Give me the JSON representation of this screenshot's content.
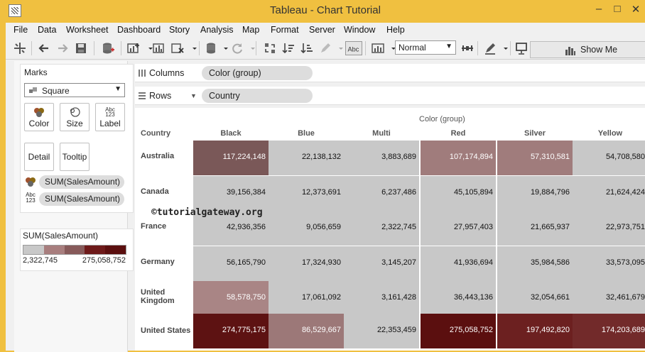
{
  "window": {
    "title": "Tableau - Chart Tutorial",
    "minimize": "‒",
    "maximize": "□",
    "close": "✕"
  },
  "menu": [
    "File",
    "Data",
    "Worksheet",
    "Dashboard",
    "Story",
    "Analysis",
    "Map",
    "Format",
    "Server",
    "Window",
    "Help"
  ],
  "toolbar": {
    "fit_value": "Normal",
    "show_me": "Show Me"
  },
  "marks": {
    "title": "Marks",
    "mark_type": "Square",
    "buttons": [
      "Color",
      "Size",
      "Label",
      "Detail",
      "Tooltip"
    ],
    "pills": [
      "SUM(SalesAmount)",
      "SUM(SalesAmount)"
    ],
    "label_icon_text": "Abc\n123"
  },
  "legend": {
    "title": "SUM(SalesAmount)",
    "min": "2,322,745",
    "max": "275,058,752",
    "colors": [
      "#c8c8c8",
      "#a87e7e",
      "#875a5a",
      "#6e1a1a",
      "#5b0f0f"
    ]
  },
  "shelves": {
    "columns_label": "Columns",
    "columns_pill": "Color (group)",
    "rows_label": "Rows",
    "rows_pill": "Country"
  },
  "table": {
    "group_title": "Color (group)",
    "row_header_title": "Country",
    "columns": [
      "Black",
      "Blue",
      "Multi",
      "Red",
      "Silver",
      "Yellow"
    ],
    "rows": [
      {
        "country": "Australia",
        "values": [
          "117,224,148",
          "22,138,132",
          "3,883,689",
          "107,174,894",
          "57,310,581",
          "54,708,580"
        ],
        "bg": [
          "#7a5858",
          "#c8c8c8",
          "#c8c8c8",
          "#a07c7c",
          "#a07c7c",
          "#c8c8c8"
        ],
        "fg": [
          "#fff",
          "#111",
          "#111",
          "#fff",
          "#fff",
          "#111"
        ]
      },
      {
        "country": "Canada",
        "values": [
          "39,156,384",
          "12,373,691",
          "6,237,486",
          "45,105,894",
          "19,884,796",
          "21,624,424"
        ],
        "bg": [
          "#c8c8c8",
          "#c8c8c8",
          "#c8c8c8",
          "#c8c8c8",
          "#c8c8c8",
          "#c8c8c8"
        ],
        "fg": [
          "#111",
          "#111",
          "#111",
          "#111",
          "#111",
          "#111"
        ]
      },
      {
        "country": "France",
        "values": [
          "42,936,356",
          "9,056,659",
          "2,322,745",
          "27,957,403",
          "21,665,937",
          "22,973,751"
        ],
        "bg": [
          "#c8c8c8",
          "#c8c8c8",
          "#c8c8c8",
          "#c8c8c8",
          "#c8c8c8",
          "#c8c8c8"
        ],
        "fg": [
          "#111",
          "#111",
          "#111",
          "#111",
          "#111",
          "#111"
        ]
      },
      {
        "country": "Germany",
        "values": [
          "56,165,790",
          "17,324,930",
          "3,145,207",
          "41,936,694",
          "35,984,586",
          "33,573,095"
        ],
        "bg": [
          "#c8c8c8",
          "#c8c8c8",
          "#c8c8c8",
          "#c8c8c8",
          "#c8c8c8",
          "#c8c8c8"
        ],
        "fg": [
          "#111",
          "#111",
          "#111",
          "#111",
          "#111",
          "#111"
        ]
      },
      {
        "country": "United Kingdom",
        "values": [
          "58,578,750",
          "17,061,092",
          "3,161,428",
          "36,443,136",
          "32,054,661",
          "32,461,679"
        ],
        "bg": [
          "#a98585",
          "#c8c8c8",
          "#c8c8c8",
          "#c8c8c8",
          "#c8c8c8",
          "#c8c8c8"
        ],
        "fg": [
          "#fff",
          "#111",
          "#111",
          "#111",
          "#111",
          "#111"
        ]
      },
      {
        "country": "United States",
        "values": [
          "274,775,175",
          "86,529,667",
          "22,353,459",
          "275,058,752",
          "197,492,820",
          "174,203,689"
        ],
        "bg": [
          "#5d1212",
          "#9c7878",
          "#c8c8c8",
          "#5b0f0f",
          "#6c2020",
          "#722a2a"
        ],
        "fg": [
          "#fff",
          "#fff",
          "#111",
          "#fff",
          "#fff",
          "#fff"
        ]
      }
    ]
  },
  "watermark": "©tutorialgateway.org"
}
